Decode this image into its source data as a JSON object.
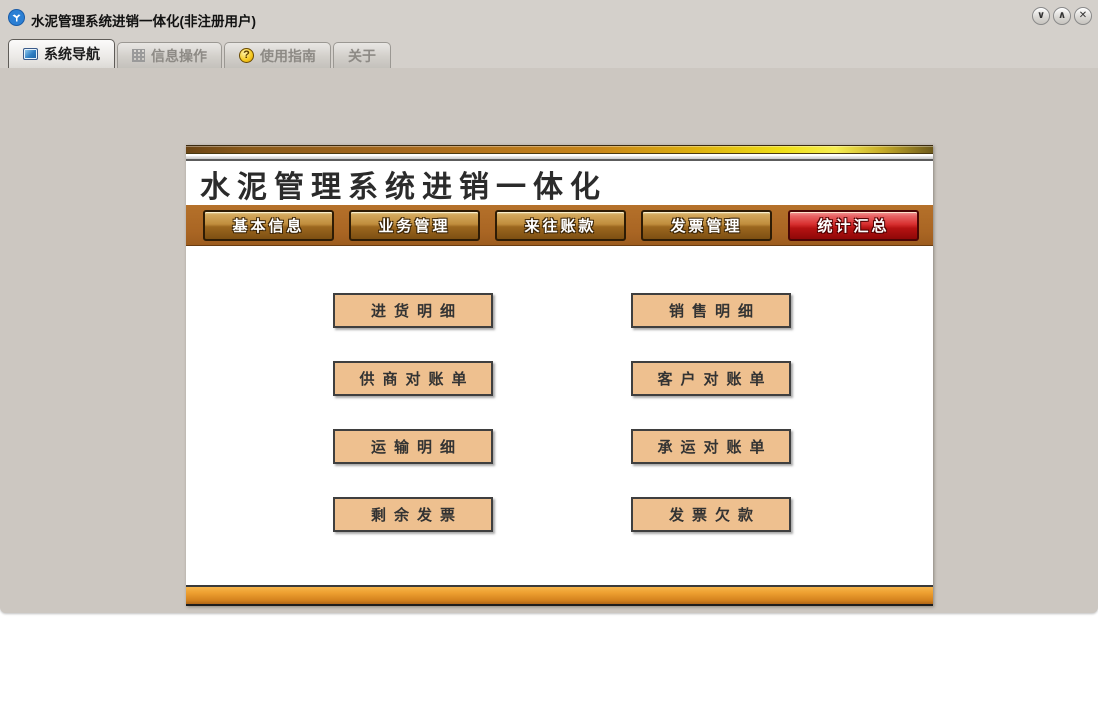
{
  "window": {
    "title": "水泥管理系统进销一体化(非注册用户)",
    "app_icon": "cloud-logo-icon",
    "controls": {
      "minimize_glyph": "∨",
      "maximize_glyph": "∧",
      "close_glyph": "✕"
    }
  },
  "tabs": {
    "items": [
      {
        "label": "系统导航",
        "icon": "monitor-icon",
        "active": true
      },
      {
        "label": "信息操作",
        "icon": "grid-icon",
        "active": false
      },
      {
        "label": "使用指南",
        "icon": "help-icon",
        "active": false
      },
      {
        "label": "关于",
        "icon": "none",
        "active": false
      }
    ]
  },
  "panel": {
    "title": "水泥管理系统进销一体化",
    "menu": {
      "items": [
        {
          "label": "基本信息",
          "style": "gold"
        },
        {
          "label": "业务管理",
          "style": "gold"
        },
        {
          "label": "来往账款",
          "style": "gold"
        },
        {
          "label": "发票管理",
          "style": "gold"
        },
        {
          "label": "统计汇总",
          "style": "red-active"
        }
      ]
    },
    "nav": {
      "left": [
        "进货明细",
        "供商对账单",
        "运输明细",
        "剩余发票"
      ],
      "right": [
        "销售明细",
        "客户对账单",
        "承运对账单",
        "发票欠款"
      ]
    },
    "colors": {
      "menu_bar": "#a96523",
      "menu_button_gold": "#c08d3d",
      "menu_button_active_red": "#d83030",
      "nav_button_tan": "#eec08f",
      "stripe_gold_yellow": "#efdf18"
    }
  }
}
